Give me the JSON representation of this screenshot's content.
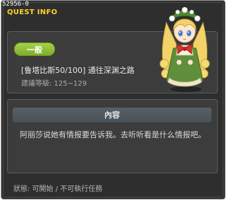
{
  "quest": {
    "id": "52956-0",
    "panel_title": "QUEST INFO",
    "category": "一般",
    "title": "[鲁塔比斯50/100] 通往深渊之路",
    "level_label": "建議等級: 125~129",
    "content_header": "內容",
    "description": "阿丽莎说她有情报要告诉我。去听听看是什么情报吧。",
    "status_label": "狀態:  可開始 / 不可執行任務"
  },
  "colors": {
    "window_bg": "#2e2e2e",
    "panel_bg": "#3c3c3c",
    "accent_yellow": "#ffd428",
    "badge_green": "#8fbf34",
    "content_header_bg": "#505a62"
  },
  "npc": {
    "icon": "npc-portrait-blonde-girl"
  }
}
